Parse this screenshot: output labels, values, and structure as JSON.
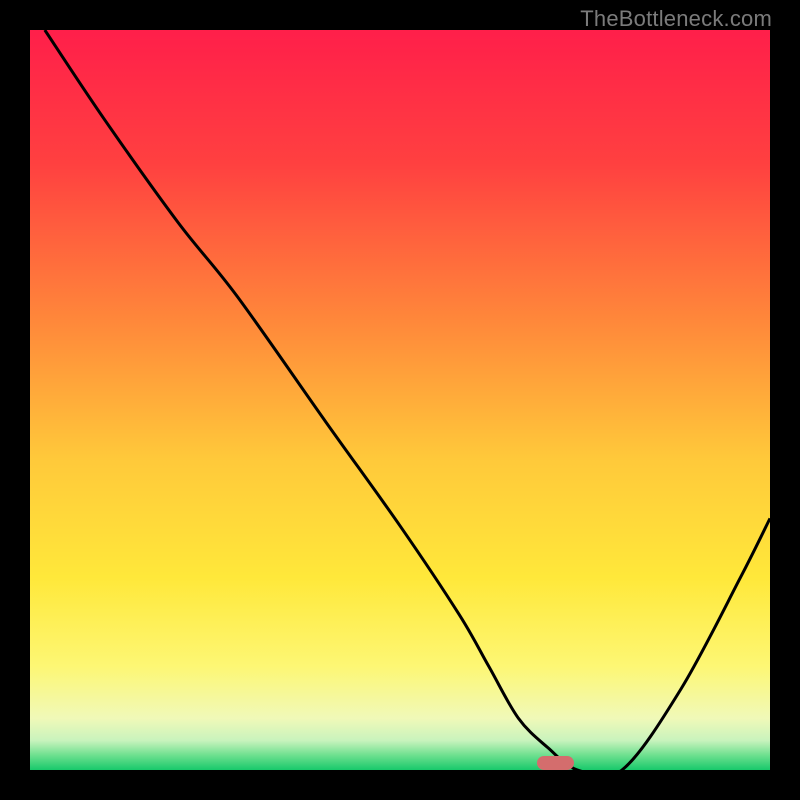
{
  "attribution": "TheBottleneck.com",
  "chart_data": {
    "type": "line",
    "title": "",
    "xlabel": "",
    "ylabel": "",
    "xlim": [
      0,
      100
    ],
    "ylim": [
      0,
      100
    ],
    "x": [
      2,
      10,
      20,
      28,
      40,
      50,
      58,
      62,
      66,
      70,
      74,
      80,
      88,
      96,
      100
    ],
    "values": [
      100,
      88,
      74,
      64,
      47,
      33,
      21,
      14,
      7,
      3,
      0,
      0,
      11,
      26,
      34
    ],
    "indicator_x": 71,
    "indicator_width": 5,
    "gradient_stops": [
      {
        "offset": 0,
        "color": "#ff1f4a"
      },
      {
        "offset": 18,
        "color": "#ff4040"
      },
      {
        "offset": 40,
        "color": "#ff8a3a"
      },
      {
        "offset": 58,
        "color": "#ffc93a"
      },
      {
        "offset": 74,
        "color": "#ffe83a"
      },
      {
        "offset": 86,
        "color": "#fdf774"
      },
      {
        "offset": 93,
        "color": "#f0f9b8"
      },
      {
        "offset": 96,
        "color": "#c9f3bd"
      },
      {
        "offset": 98,
        "color": "#6ee08f"
      },
      {
        "offset": 100,
        "color": "#18c96b"
      }
    ]
  }
}
